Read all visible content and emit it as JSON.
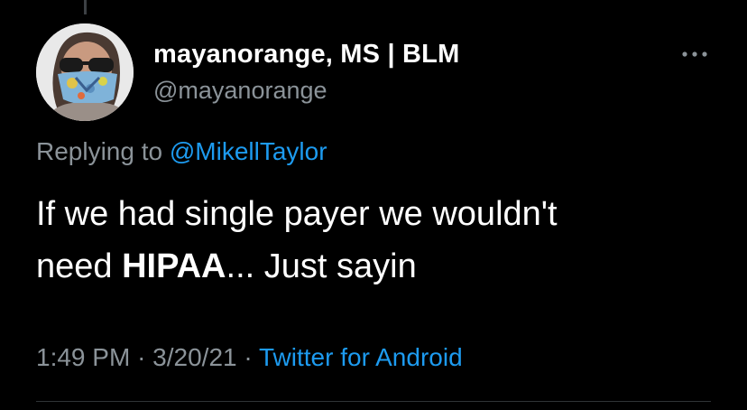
{
  "author": {
    "display_name": "mayanorange, MS | BLM",
    "handle": "@mayanorange",
    "avatar_icon": "profile-photo-masked-person"
  },
  "more_icon": "more-horizontal-icon",
  "reply": {
    "prefix": "Replying to",
    "mention": "@MikellTaylor"
  },
  "tweet": {
    "line1": "If we had single payer we wouldn't",
    "line2_before": "need ",
    "line2_bold": "HIPAA",
    "line2_after": "... Just sayin"
  },
  "meta": {
    "time": "1:49 PM",
    "separator": "·",
    "date": "3/20/21",
    "source": "Twitter for Android"
  },
  "colors": {
    "background": "#000000",
    "text_primary": "#ffffff",
    "text_secondary": "#8b9399",
    "link": "#1d9bf0",
    "divider": "#2f3336"
  }
}
